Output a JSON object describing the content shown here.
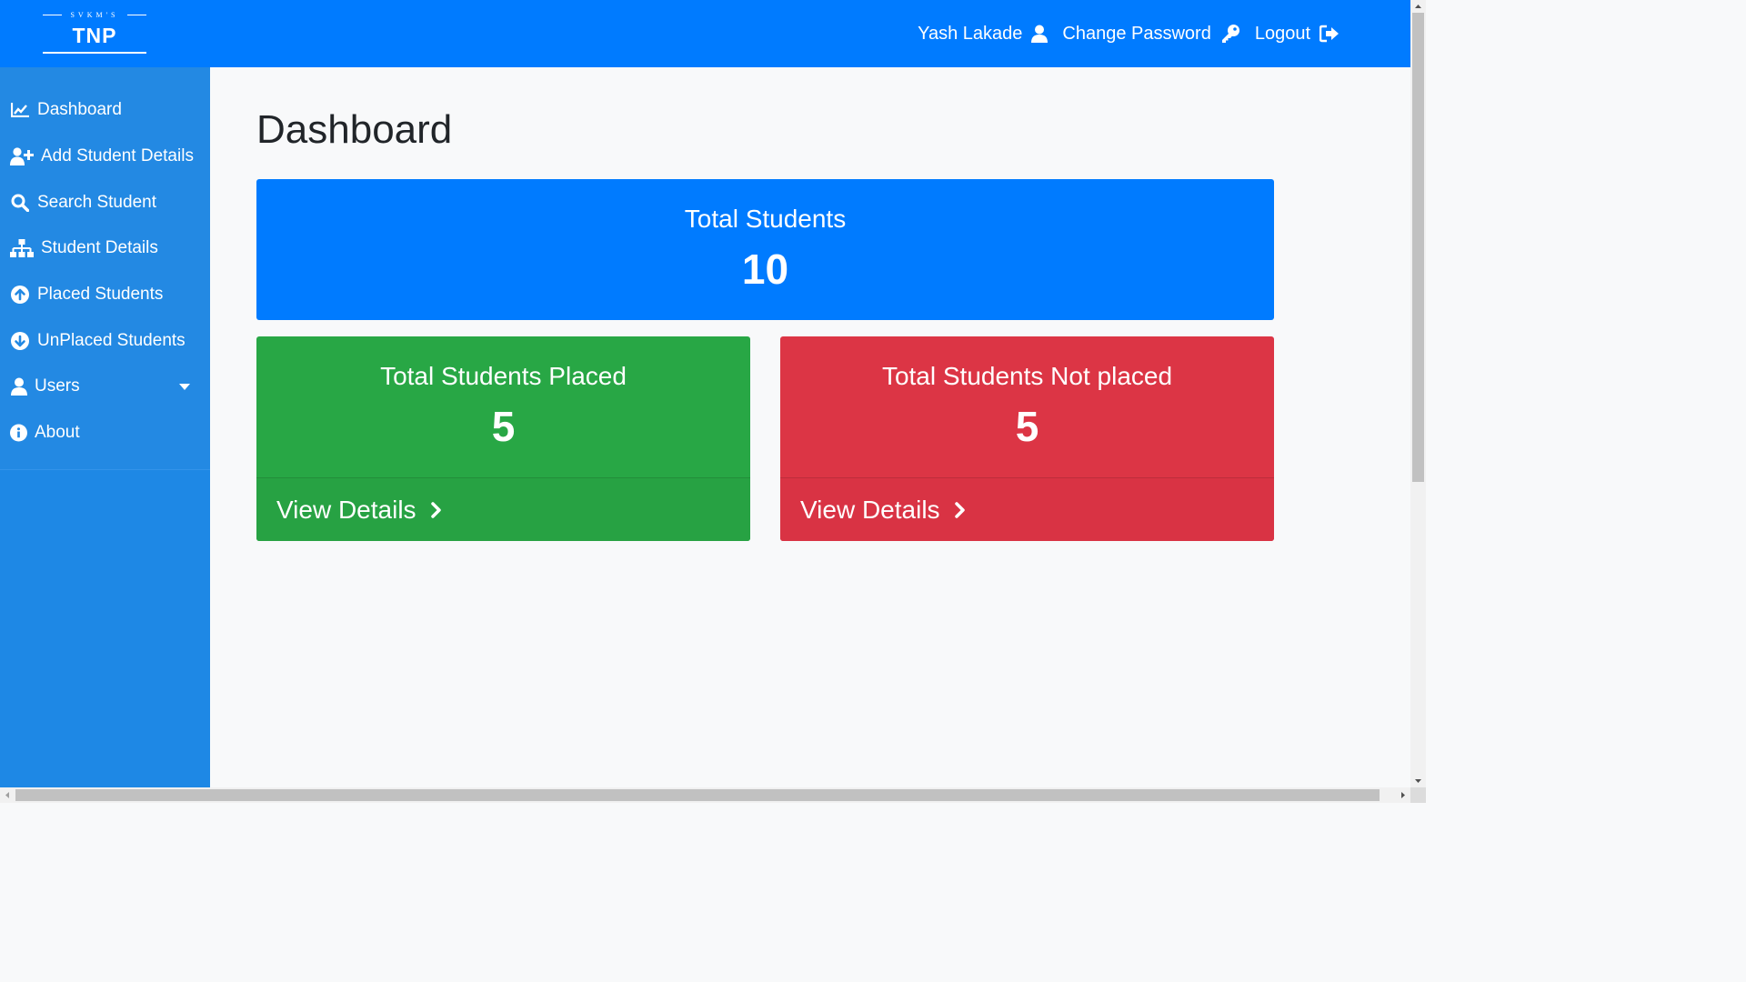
{
  "header": {
    "logo": {
      "subtitle": "SVKM'S",
      "title": "TNP"
    },
    "user_name": "Yash Lakade",
    "change_password": "Change Password",
    "logout": "Logout"
  },
  "sidebar": {
    "items": [
      {
        "label": "Dashboard",
        "icon": "chart-line-icon"
      },
      {
        "label": "Add Student Details",
        "icon": "user-plus-icon"
      },
      {
        "label": "Search Student",
        "icon": "search-icon"
      },
      {
        "label": "Student Details",
        "icon": "sitemap-icon"
      },
      {
        "label": "Placed Students",
        "icon": "arrow-circle-up-icon"
      },
      {
        "label": "UnPlaced Students",
        "icon": "arrow-circle-down-icon"
      },
      {
        "label": "Users",
        "icon": "user-icon"
      },
      {
        "label": "About",
        "icon": "info-circle-icon"
      }
    ]
  },
  "main": {
    "title": "Dashboard",
    "cards": {
      "total": {
        "label": "Total Students",
        "value": "10"
      },
      "placed": {
        "label": "Total Students Placed",
        "value": "5",
        "footer": "View Details"
      },
      "unplaced": {
        "label": "Total Students Not placed",
        "value": "5",
        "footer": "View Details"
      }
    }
  },
  "colors": {
    "primary": "#007bff",
    "sidebar": "#1e88e5",
    "success": "#28a745",
    "danger": "#dc3545",
    "background": "#f8f9fa"
  }
}
